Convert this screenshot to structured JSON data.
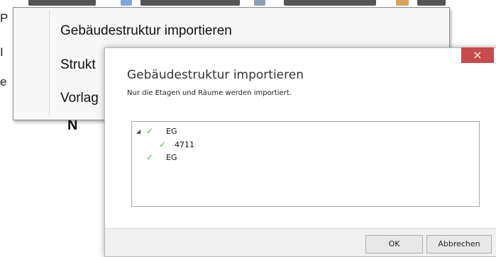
{
  "context_menu": {
    "items": [
      {
        "label": "Gebäudestruktur importieren"
      },
      {
        "label": "Strukt"
      },
      {
        "label": "Vorlag"
      }
    ]
  },
  "dialog": {
    "close_glyph": "×",
    "title": "Gebäudestruktur importieren",
    "subtitle": "Nur die Etagen und Räume werden importiert.",
    "tree": [
      {
        "label": "EG",
        "checked": true,
        "expanded": true,
        "level": 0
      },
      {
        "label": "4711",
        "checked": true,
        "level": 1
      },
      {
        "label": "EG",
        "checked": true,
        "level": 0
      }
    ],
    "ok_label": "OK",
    "cancel_label": "Abbrechen"
  },
  "background": {
    "left_fragments": [
      "P",
      "I",
      "e"
    ],
    "bottom_fragment": "N"
  },
  "colors": {
    "close_button": "#c74b4b",
    "check": "#55b84a"
  }
}
